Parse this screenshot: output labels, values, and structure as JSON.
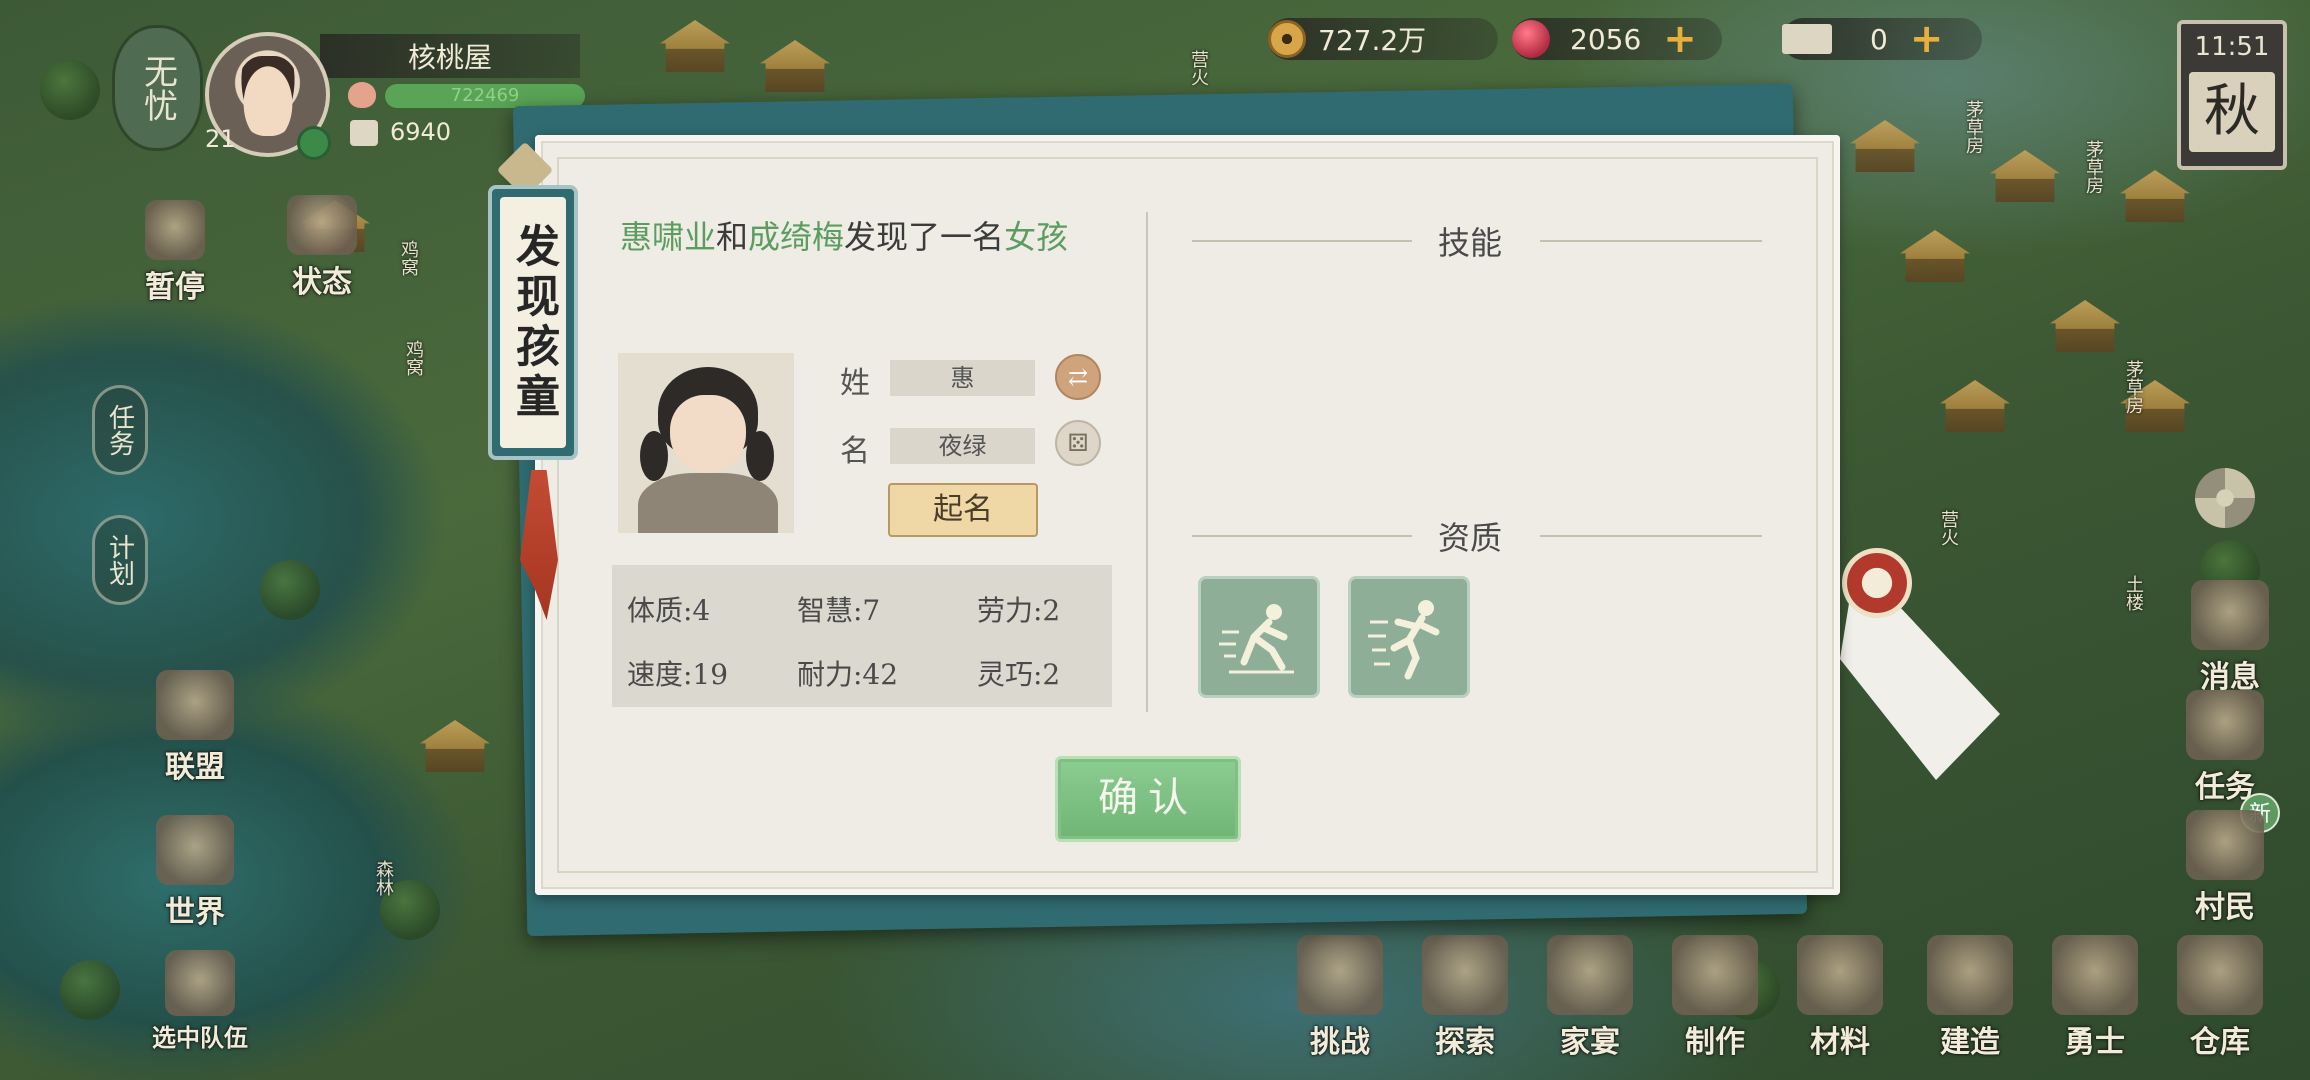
{
  "top_bar": {
    "status_label": "无忧",
    "player_name": "核桃屋",
    "player_level": "21",
    "peach_value": "722469",
    "stock_value": "6940",
    "coins": "727.2万",
    "gems": "2056",
    "tickets": "0",
    "clock_time": "11:51",
    "season": "秋"
  },
  "left_menu": {
    "pause": "暂停",
    "status": "状态",
    "task_vertical": "任务",
    "plan_vertical": "计划",
    "alliance": "联盟",
    "world": "世界",
    "select_team": "选中队伍"
  },
  "right_menu": {
    "messages": "消息",
    "tasks": "任务",
    "new_badge": "新",
    "villagers": "村民"
  },
  "bottom_menu": [
    {
      "label": "挑战",
      "name": "challenge"
    },
    {
      "label": "探索",
      "name": "explore"
    },
    {
      "label": "家宴",
      "name": "banquet"
    },
    {
      "label": "制作",
      "name": "craft"
    },
    {
      "label": "材料",
      "name": "materials"
    },
    {
      "label": "建造",
      "name": "build"
    },
    {
      "label": "勇士",
      "name": "warriors"
    },
    {
      "label": "仓库",
      "name": "warehouse"
    }
  ],
  "dialog": {
    "title": "发现孩童",
    "discover_parent1": "惠啸业",
    "discover_and": "和",
    "discover_parent2": "成绮梅",
    "discover_mid": "发现了一名",
    "discover_gender": "女孩",
    "surname_label": "姓",
    "surname_value": "惠",
    "given_label": "名",
    "given_value": "夜绿",
    "name_button": "起名",
    "stats": {
      "constitution": "体质:4",
      "wisdom": "智慧:7",
      "labor": "劳力:2",
      "speed": "速度:19",
      "endurance": "耐力:42",
      "dexterity": "灵巧:2"
    },
    "skills_title": "技能",
    "aptitude_title": "资质",
    "confirm": "确认"
  },
  "map_tags": [
    "营火",
    "茅草房",
    "茅草房",
    "茅草房",
    "鸡窝",
    "鸡窝",
    "营火",
    "土楼",
    "森林"
  ]
}
